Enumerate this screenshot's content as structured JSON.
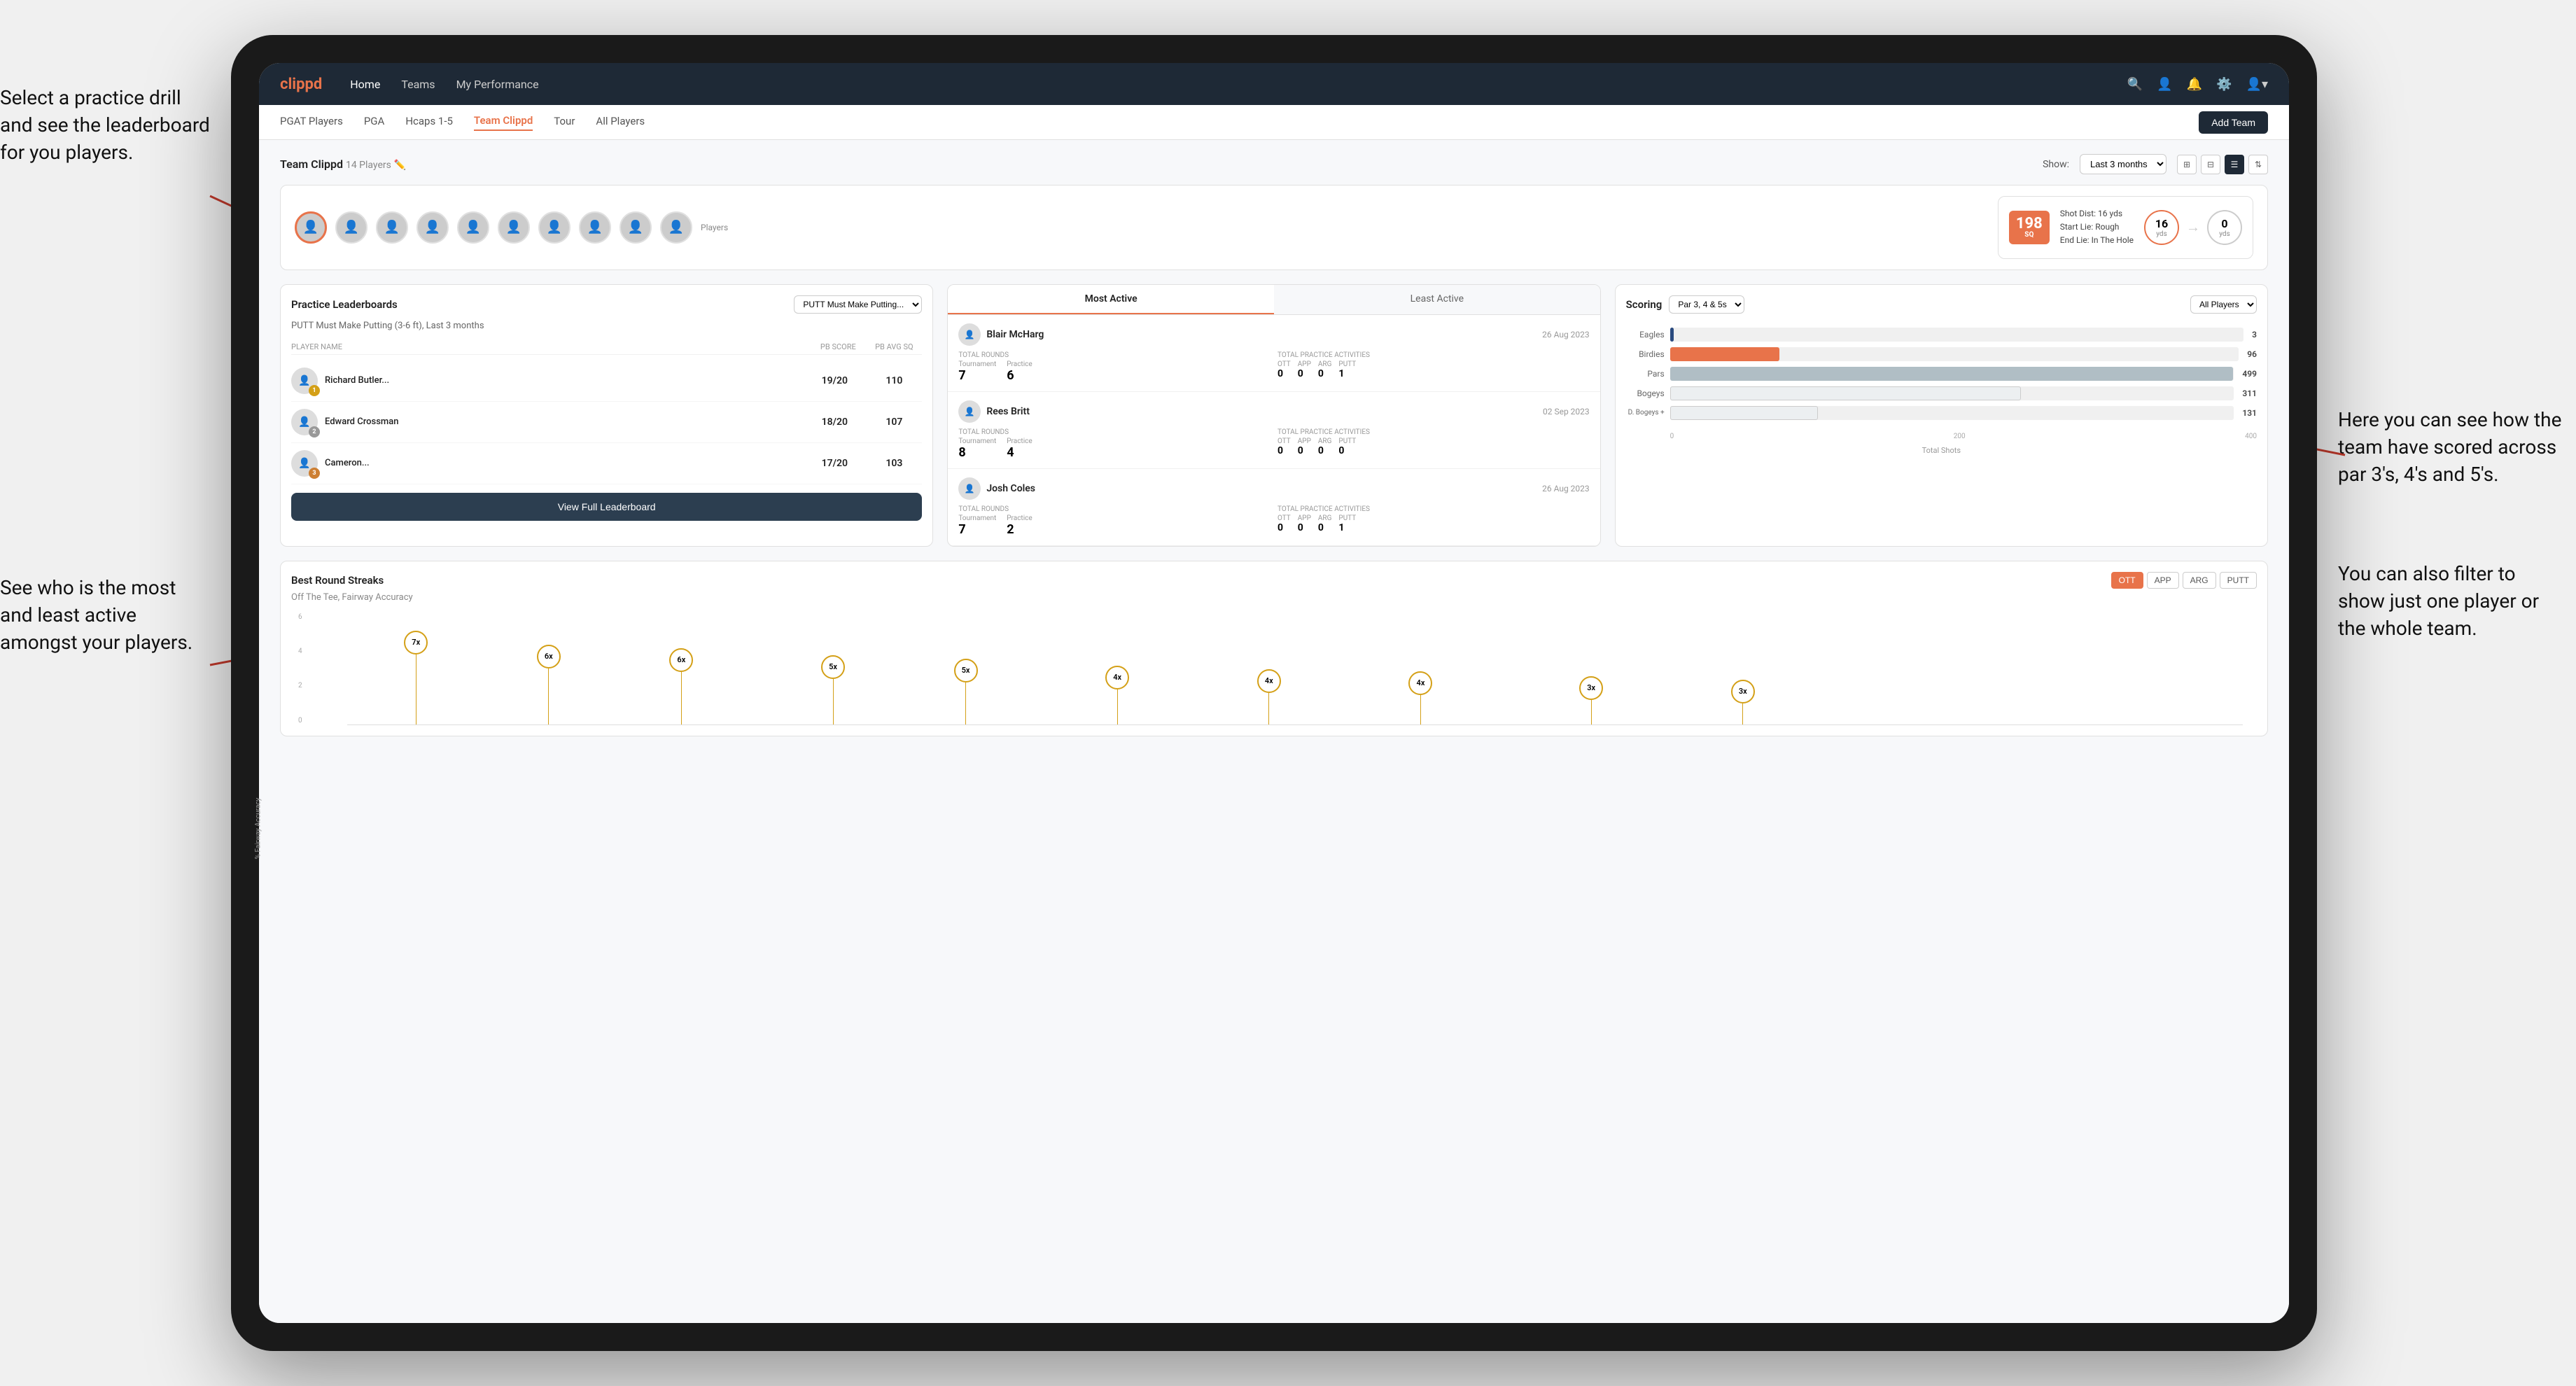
{
  "annotations": {
    "top_left": "Select a practice drill and see the leaderboard for you players.",
    "bottom_left": "See who is the most and least active amongst your players.",
    "top_right": "Here you can see how the team have scored across par 3's, 4's and 5's.",
    "bottom_right": "You can also filter to show just one player or the whole team."
  },
  "nav": {
    "logo": "clippd",
    "links": [
      "Home",
      "Teams",
      "My Performance"
    ],
    "icons": [
      "search",
      "person",
      "bell",
      "settings",
      "profile"
    ]
  },
  "sub_nav": {
    "links": [
      "PGAT Players",
      "PGA",
      "Hcaps 1-5",
      "Team Clippd",
      "Tour",
      "All Players"
    ],
    "active": "Team Clippd",
    "add_team_btn": "Add Team"
  },
  "team_header": {
    "title": "Team Clippd",
    "player_count": "14 Players",
    "show_label": "Show:",
    "show_value": "Last 3 months",
    "views": [
      "grid-large",
      "grid-small",
      "list",
      "sort"
    ]
  },
  "shot_info": {
    "badge_number": "198",
    "badge_label": "SQ",
    "details": [
      "Shot Dist: 16 yds",
      "Start Lie: Rough",
      "End Lie: In The Hole"
    ],
    "circle1_value": "16",
    "circle1_label": "yds",
    "circle2_value": "0",
    "circle2_label": "yds"
  },
  "leaderboard": {
    "title": "Practice Leaderboards",
    "filter": "PUTT Must Make Putting...",
    "subtitle": "PUTT Must Make Putting (3-6 ft), Last 3 months",
    "headers": [
      "PLAYER NAME",
      "PB SCORE",
      "PB AVG SQ"
    ],
    "players": [
      {
        "name": "Richard Butler...",
        "score": "19/20",
        "avg": "110",
        "badge": "gold",
        "badge_num": "1"
      },
      {
        "name": "Edward Crossman",
        "score": "18/20",
        "avg": "107",
        "badge": "silver",
        "badge_num": "2"
      },
      {
        "name": "Cameron...",
        "score": "17/20",
        "avg": "103",
        "badge": "bronze",
        "badge_num": "3"
      }
    ],
    "view_full_btn": "View Full Leaderboard"
  },
  "activity": {
    "tabs": [
      "Most Active",
      "Least Active"
    ],
    "active_tab": "Most Active",
    "players": [
      {
        "name": "Blair McHarg",
        "date": "26 Aug 2023",
        "total_rounds_label": "Total Rounds",
        "tournament": "7",
        "practice": "6",
        "total_practice_label": "Total Practice Activities",
        "ott": "0",
        "app": "0",
        "arg": "0",
        "putt": "1"
      },
      {
        "name": "Rees Britt",
        "date": "02 Sep 2023",
        "total_rounds_label": "Total Rounds",
        "tournament": "8",
        "practice": "4",
        "total_practice_label": "Total Practice Activities",
        "ott": "0",
        "app": "0",
        "arg": "0",
        "putt": "0"
      },
      {
        "name": "Josh Coles",
        "date": "26 Aug 2023",
        "total_rounds_label": "Total Rounds",
        "tournament": "7",
        "practice": "2",
        "total_practice_label": "Total Practice Activities",
        "ott": "0",
        "app": "0",
        "arg": "0",
        "putt": "1"
      }
    ]
  },
  "scoring": {
    "title": "Scoring",
    "filter1": "Par 3, 4 & 5s",
    "filter2": "All Players",
    "bars": [
      {
        "label": "Eagles",
        "value": 3,
        "max": 500,
        "type": "eagles"
      },
      {
        "label": "Birdies",
        "value": 96,
        "max": 500,
        "type": "birdies"
      },
      {
        "label": "Pars",
        "value": 499,
        "max": 500,
        "type": "pars"
      },
      {
        "label": "Bogeys",
        "value": 311,
        "max": 500,
        "type": "bogeys"
      },
      {
        "label": "D. Bogeys +",
        "value": 131,
        "max": 500,
        "type": "dbogeys"
      }
    ],
    "axis": [
      "0",
      "200",
      "400"
    ],
    "footer": "Total Shots"
  },
  "streaks": {
    "title": "Best Round Streaks",
    "filters": [
      "OTT",
      "APP",
      "ARG",
      "PUTT"
    ],
    "active_filter": "OTT",
    "subtitle": "Off The Tee, Fairway Accuracy",
    "points": [
      {
        "x": 8,
        "y": 20,
        "label": "7x"
      },
      {
        "x": 15,
        "y": 55,
        "label": "6x"
      },
      {
        "x": 22,
        "y": 55,
        "label": "6x"
      },
      {
        "x": 30,
        "y": 72,
        "label": "5x"
      },
      {
        "x": 38,
        "y": 72,
        "label": "5x"
      },
      {
        "x": 47,
        "y": 80,
        "label": "4x"
      },
      {
        "x": 55,
        "y": 80,
        "label": "4x"
      },
      {
        "x": 62,
        "y": 80,
        "label": "4x"
      },
      {
        "x": 70,
        "y": 88,
        "label": "3x"
      },
      {
        "x": 78,
        "y": 88,
        "label": "3x"
      }
    ]
  },
  "players_row": {
    "label": "Players",
    "count": 10
  },
  "all_players_label": "All Players"
}
